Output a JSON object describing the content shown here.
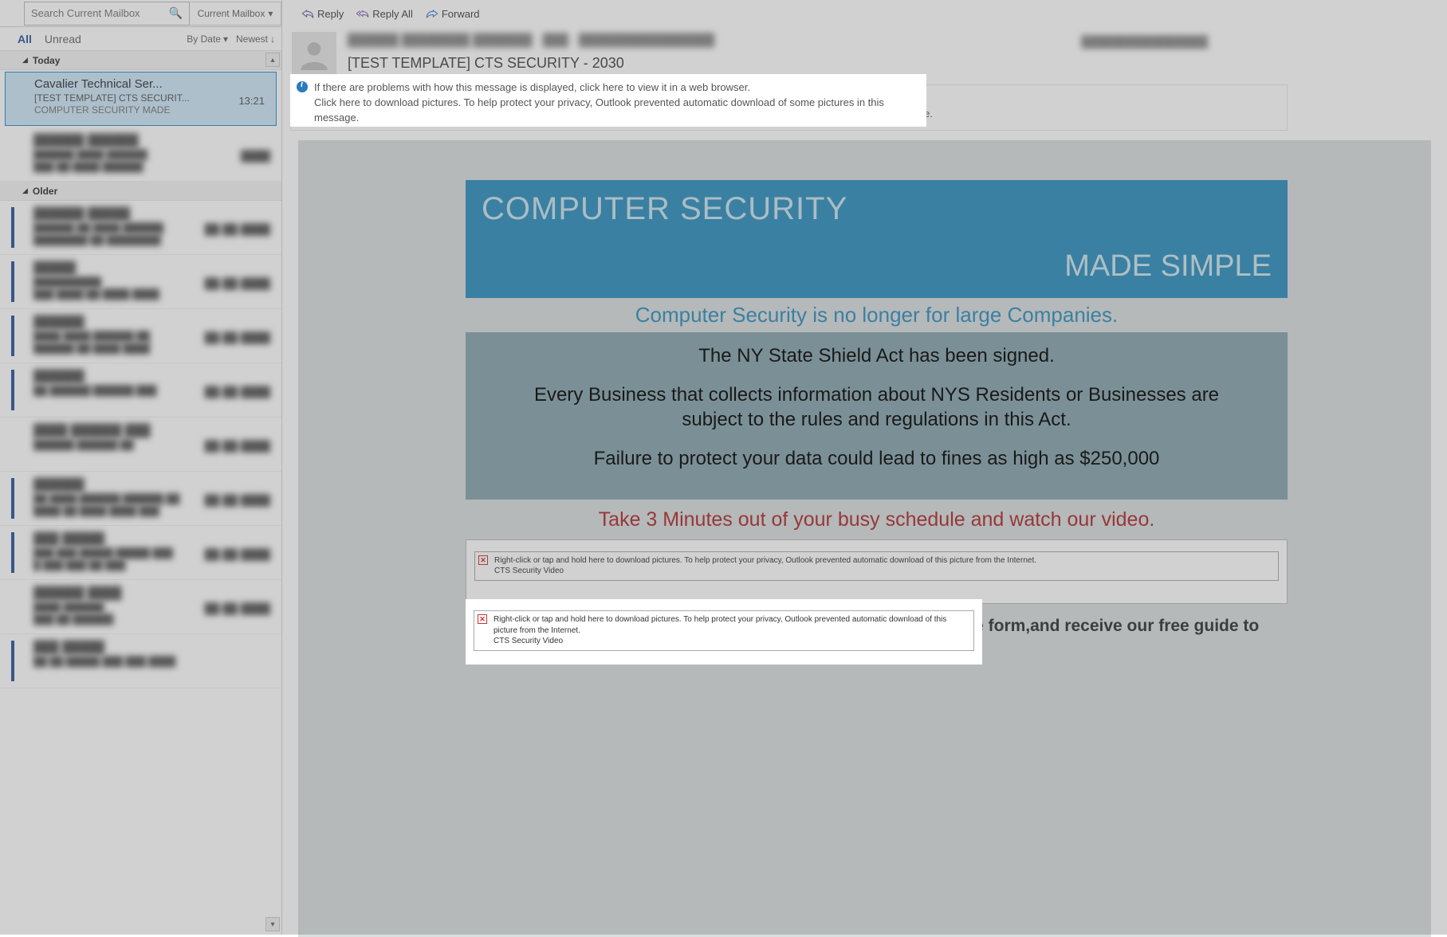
{
  "search": {
    "placeholder": "Search Current Mailbox",
    "scope": "Current Mailbox"
  },
  "filters": {
    "all": "All",
    "unread": "Unread",
    "sort": "By Date",
    "order": "Newest"
  },
  "groups": {
    "today": "Today",
    "older": "Older"
  },
  "selected_msg": {
    "sender": "Cavalier Technical Ser...",
    "subject": "[TEST TEMPLATE] CTS SECURIT...",
    "preview": "COMPUTER SECURITY  MADE",
    "time": "13:21"
  },
  "blurred_items": [
    {
      "sender": "██████ ██████",
      "subject": "██████ ████ ██████",
      "preview": "███ ██ ████ ██████",
      "time": "████"
    },
    {
      "sender": "██████ █████",
      "subject": "██████ ██ ████ ██████",
      "preview": "████████ ██ ████████",
      "time": "██-██-████"
    },
    {
      "sender": "█████",
      "subject": "██████████",
      "preview": "███ ████ ██ ████ ████",
      "time": "██-██-████"
    },
    {
      "sender": "██████",
      "subject": "████ ████ ██████ ██",
      "preview": "██████ ██ ████ ████",
      "time": "██-██-████"
    },
    {
      "sender": "██████",
      "subject": "██ ██████ ██████ ███",
      "preview": "",
      "time": "██-██-████"
    },
    {
      "sender": "████ ██████ ███",
      "subject": "██████ ██████ ██",
      "preview": "",
      "time": "██-██-████"
    },
    {
      "sender": "██████",
      "subject": "██ ████ ██████ ██████ ██",
      "preview": "████ ██ ████ ████ ███",
      "time": "██-██-████"
    },
    {
      "sender": "███ █████",
      "subject": "███ ███ █████ █████ ███",
      "preview": "█ ███ ███ ██ ███",
      "time": "██-██-████"
    },
    {
      "sender": "██████ ████",
      "subject": "████ ██████",
      "preview": "███ ██ ██████",
      "time": "██-██-████"
    },
    {
      "sender": "███ █████",
      "subject": "██ ██ █████ ███ ███ ████",
      "preview": "",
      "time": ""
    }
  ],
  "actions": {
    "reply": "Reply",
    "reply_all": "Reply All",
    "forward": "Forward"
  },
  "header": {
    "from": "██████ ████████ ███████ · ███ · ████████████████",
    "to": "████████████████",
    "subject": "[TEST TEMPLATE] CTS SECURITY - 2030"
  },
  "infobar": {
    "line1": "If there are problems with how this message is displayed, click here to view it in a web browser.",
    "line2": "Click here to download pictures. To help protect your privacy, Outlook prevented automatic download of some pictures in this message."
  },
  "body": {
    "banner_title": "COMPUTER SECURITY",
    "banner_sub": "MADE SIMPLE",
    "subhead": "Computer Security is no longer for large Companies.",
    "p1": "The NY State Shield Act has been signed.",
    "p2": "Every Business that collects information about NYS Residents or Businesses   are subject to the rules and regulations in this Act.",
    "p3": "Failure to protect your data could lead to fines as high as  $250,000",
    "cta": "Take 3 Minutes out of your busy schedule and watch our video.",
    "blocked_line1": "Right-click or tap and hold here to download pictures. To help protect your privacy, Outlook prevented automatic download of this picture from the Internet.",
    "blocked_line2": "CTS Security Video",
    "finish": "When you have finished watching the video please complete the form,and receive our free guide to Computer Security"
  }
}
